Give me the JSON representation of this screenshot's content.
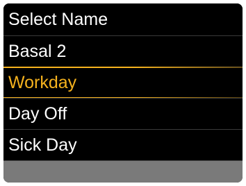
{
  "screen": {
    "title": "Select Name",
    "selected_index": 1,
    "accent_color": "#f5b21e",
    "items": [
      {
        "label": "Basal 2"
      },
      {
        "label": "Workday"
      },
      {
        "label": "Day Off"
      },
      {
        "label": "Sick Day"
      }
    ]
  }
}
